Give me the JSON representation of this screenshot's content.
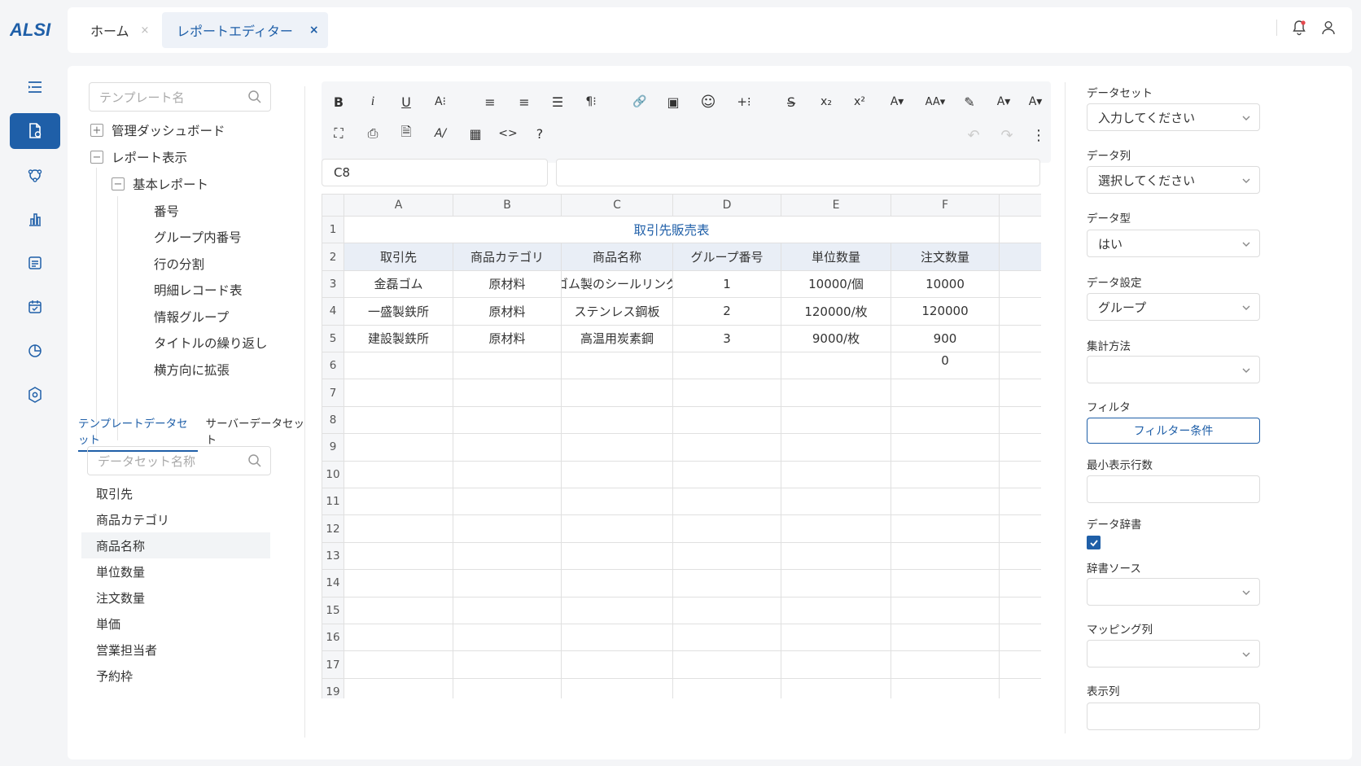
{
  "app": {
    "logo_text": "ALSI"
  },
  "tabs": [
    {
      "label": "ホーム",
      "close": "×"
    },
    {
      "label": "レポートエディター",
      "close": "×"
    }
  ],
  "template_search": {
    "placeholder": "テンプレート名"
  },
  "tree": [
    {
      "pm": "+",
      "label": "管理ダッシュボード"
    },
    {
      "pm": "−",
      "label": "レポート表示"
    },
    {
      "pm": "−",
      "label": "基本レポート"
    },
    {
      "label": "番号"
    },
    {
      "label": "グループ内番号"
    },
    {
      "label": "行の分割"
    },
    {
      "label": "明細レコード表"
    },
    {
      "label": "情報グループ"
    },
    {
      "label": "タイトルの繰り返し"
    },
    {
      "label": "横方向に拡張"
    }
  ],
  "dataset_tabs": [
    "テンプレートデータセット",
    "サーバーデータセット"
  ],
  "dataset_search": {
    "placeholder": "データセット名称"
  },
  "dataset_items": [
    "取引先",
    "商品カテゴリ",
    "商品名称",
    "単位数量",
    "注文数量",
    "単価",
    "営業担当者",
    "予約枠"
  ],
  "toolbar": {
    "row1": [
      "B",
      "i",
      "U",
      "A⁝",
      "≡",
      "≡",
      "☰",
      "¶⁝",
      "🔗",
      "▣",
      "☺",
      "+⁝",
      "S̶",
      "x₂",
      "x²",
      "A▾",
      "AA▾",
      "✎",
      "A▾",
      "A▾"
    ],
    "row2": [
      "⛶",
      "⎙",
      "🗎",
      "A/",
      "▦",
      "<>",
      "?"
    ],
    "undo": "↶",
    "redo": "↷",
    "more": "⋮"
  },
  "cell_ref": "C8",
  "sheet": {
    "columns": [
      "A",
      "B",
      "C",
      "D",
      "E",
      "F"
    ],
    "rows": [
      "1",
      "2",
      "3",
      "4",
      "5",
      "6",
      "7",
      "8",
      "9",
      "10",
      "11",
      "12",
      "13",
      "14",
      "15",
      "16",
      "17",
      "19"
    ],
    "title": "取引先販売表",
    "headers": [
      "取引先",
      "商品カテゴリ",
      "商品名称",
      "グループ番号",
      "単位数量",
      "注文数量"
    ],
    "data": [
      [
        "金磊ゴム",
        "原材料",
        "ゴム製のシールリング",
        "1",
        "10000/個",
        "10000"
      ],
      [
        "一盛製鉄所",
        "原材料",
        "ステンレス鋼板",
        "2",
        "120000/枚",
        "120000"
      ],
      [
        "建設製鉄所",
        "原材料",
        "高温用炭素鋼",
        "3",
        "9000/枚",
        "900"
      ]
    ],
    "extra_f6": "0"
  },
  "props": {
    "dataset_label": "データセット",
    "dataset_value": "入力してください",
    "column_label": "データ列",
    "column_value": "選択してください",
    "type_label": "データ型",
    "type_value": "はい",
    "setting_label": "データ設定",
    "setting_value": "グループ",
    "agg_label": "集計方法",
    "agg_value": "",
    "filter_label": "フィルタ",
    "filter_button": "フィルター条件",
    "minrows_label": "最小表示行数",
    "minrows_value": "",
    "dict_label": "データ辞書",
    "dict_checked": true,
    "dictsrc_label": "辞書ソース",
    "dictsrc_value": "",
    "mapping_label": "マッピング列",
    "mapping_value": "",
    "display_label": "表示列"
  },
  "colors": {
    "accent": "#1f5fa8",
    "header_fill": "#e9eef6"
  }
}
